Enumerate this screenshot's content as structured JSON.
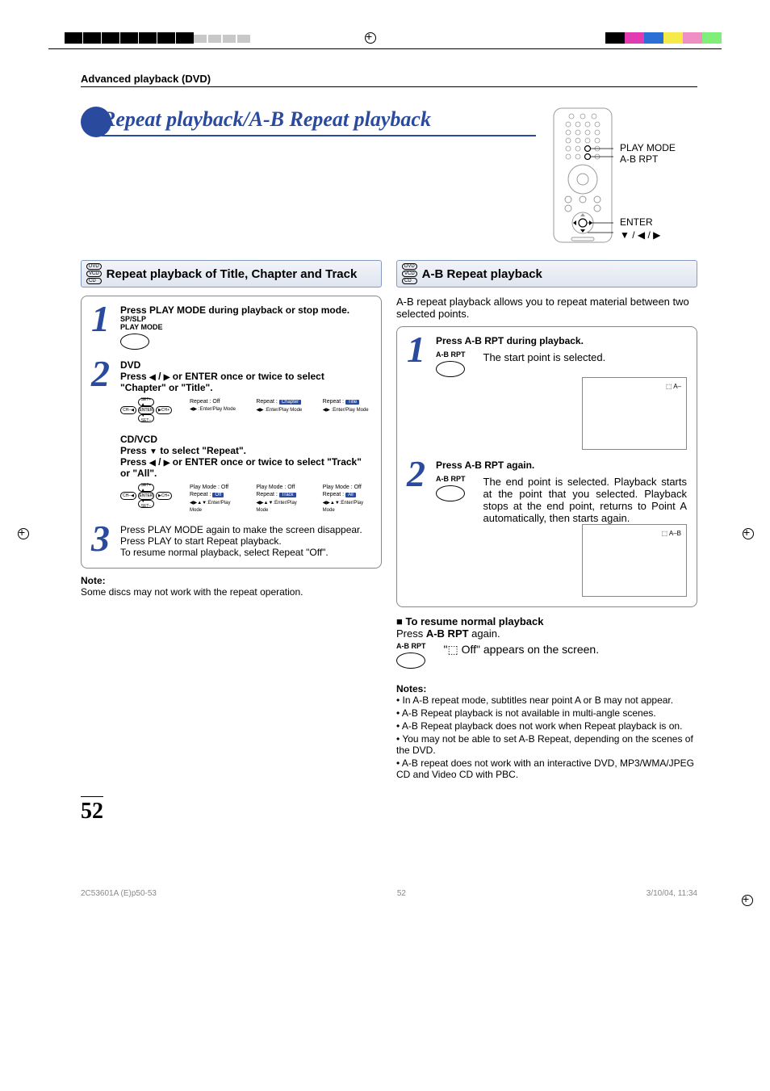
{
  "header": {
    "section": "Advanced playback (DVD)"
  },
  "title": "Repeat playback/A-B Repeat playback",
  "remote_labels": {
    "playmode": "PLAY MODE",
    "abrpt": "A-B RPT",
    "enter": "ENTER",
    "arrows": "▼ / ◀ / ▶"
  },
  "left": {
    "subhead": "Repeat playback of Title, Chapter and Track",
    "discs": [
      "DVD",
      "VCD",
      "CD"
    ],
    "step1": {
      "text": "Press PLAY MODE during playback or stop mode.",
      "btn1": "SP/SLP",
      "btn2": "PLAY MODE"
    },
    "step2": {
      "h": "DVD",
      "text_a": "Press ",
      "text_b": " / ",
      "text_c": " or ENTER once or twice to select \"Chapter\" or \"Title\".",
      "osd": [
        {
          "l1": "Repeat",
          "v": "Off",
          "l2": "◀▶ :Enter/Play Mode"
        },
        {
          "l1": "Repeat",
          "v": "Chapter",
          "l2": "◀▶ :Enter/Play Mode"
        },
        {
          "l1": "Repeat",
          "v": "Title",
          "l2": "◀▶ :Enter/Play Mode"
        }
      ],
      "h2": "CD/VCD",
      "t2a": "Press ",
      "t2b": " to select \"Repeat\".",
      "t3a": "Press ",
      "t3b": " / ",
      "t3c": " or ENTER once or twice to select \"Track\" or \"All\".",
      "osd2": [
        {
          "l0": "Play Mode",
          "v0": "Off",
          "l1": "Repeat",
          "v": "Off",
          "l2": "◀▶▲▼:Enter/Play Mode"
        },
        {
          "l0": "Play Mode",
          "v0": "Off",
          "l1": "Repeat",
          "v": "Track",
          "l2": "◀▶▲▼:Enter/Play Mode"
        },
        {
          "l0": "Play Mode",
          "v0": "Off",
          "l1": "Repeat",
          "v": "All",
          "l2": "◀▶▲▼:Enter/Play Mode"
        }
      ]
    },
    "step3": {
      "l1": "Press PLAY MODE again to make the screen disappear.",
      "l2": "Press PLAY to start Repeat playback.",
      "l3": "To resume normal playback, select Repeat \"Off\"."
    },
    "note_h": "Note:",
    "note": "Some discs may not work with the repeat operation."
  },
  "right": {
    "subhead": "A-B Repeat playback",
    "discs": [
      "DVD",
      "VCD",
      "CD"
    ],
    "intro": "A-B repeat playback allows you to repeat material between two selected points.",
    "step1": {
      "h": "Press A-B RPT during playback.",
      "btn": "A-B RPT",
      "txt": "The start point is selected.",
      "screen": "A–"
    },
    "step2": {
      "h": "Press A-B RPT again.",
      "btn": "A-B RPT",
      "txt": "The end point is selected. Playback starts at the point that you selected. Playback stops at the end point, returns to Point A automatically, then starts again.",
      "screen": "A–B"
    },
    "resume_h": "To resume normal playback",
    "resume_t1": "Press ",
    "resume_bold": "A-B RPT",
    "resume_t2": " again.",
    "resume_btn": "A-B RPT",
    "resume_screen_a": "\"",
    "resume_screen_off": " Off",
    "resume_screen_b": "\" appears on the screen.",
    "notes_h": "Notes:",
    "notes": [
      "In A-B repeat mode, subtitles near point A or B may not appear.",
      "A-B Repeat playback is not available in multi-angle scenes.",
      "A-B Repeat playback does not work when Repeat playback is on.",
      "You may not be able to set A-B Repeat, depending on the scenes of the DVD.",
      "A-B repeat does not work with an interactive DVD, MP3/WMA/JPEG CD and Video CD with PBC."
    ]
  },
  "page_number": "52",
  "footer": {
    "left": "2C53601A (E)p50-53",
    "mid": "52",
    "right": "3/10/04, 11:34"
  },
  "colors": [
    "#000000",
    "#e23ab0",
    "#2b6fd6",
    "#f6e94a",
    "#f08fc3",
    "#7fef7a"
  ]
}
